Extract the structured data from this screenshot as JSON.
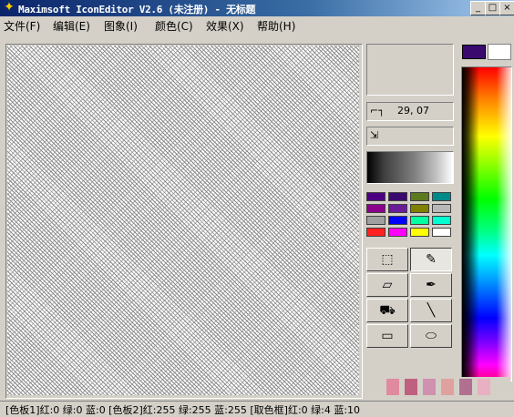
{
  "window": {
    "title": "Maximsoft IconEditor V2.6 (未注册) - 无标题",
    "app_icon": "walking-figure-icon",
    "controls": [
      "minimize-icon",
      "maximize-icon",
      "close-icon"
    ]
  },
  "menu": [
    "文件(F)",
    "编辑(E)",
    "图象(I)",
    "颜色(C)",
    "效果(X)",
    "帮助(H)"
  ],
  "info": {
    "cursor_position": "29, 07"
  },
  "colors": {
    "foreground": "#3a0a6e",
    "background": "#ffffff",
    "palette": [
      "#4b0082",
      "#3a0a6e",
      "#5c7a1e",
      "#008b8b",
      "#8b008b",
      "#6a1b9a",
      "#808000",
      "#b8b8b8",
      "#a0a0a0",
      "#0000ff",
      "#00ffa0",
      "#00ffd0",
      "#ff2020",
      "#ff00ff",
      "#ffff00",
      "#ffffff"
    ]
  },
  "tools": [
    {
      "name": "select-rect-tool",
      "icon": "dashed-rect-icon",
      "glyph": "⬚",
      "active": false
    },
    {
      "name": "pencil-tool",
      "icon": "pencil-icon",
      "glyph": "✎",
      "active": true
    },
    {
      "name": "eraser-tool",
      "icon": "eraser-icon",
      "glyph": "▱",
      "active": false
    },
    {
      "name": "eyedropper-tool",
      "icon": "eyedropper-icon",
      "glyph": "✒",
      "active": false
    },
    {
      "name": "fill-tool",
      "icon": "paint-bucket-icon",
      "glyph": "⛟",
      "active": false
    },
    {
      "name": "line-tool",
      "icon": "line-icon",
      "glyph": "╲",
      "active": false
    },
    {
      "name": "rectangle-tool",
      "icon": "rectangle-icon",
      "glyph": "▭",
      "active": false
    },
    {
      "name": "ellipse-tool",
      "icon": "ellipse-icon",
      "glyph": "⬭",
      "active": false
    }
  ],
  "status": "[色板1]红:0 绿:0 蓝:0 [色板2]红:255 绿:255 蓝:255 [取色框]红:0 绿:4 蓝:10"
}
